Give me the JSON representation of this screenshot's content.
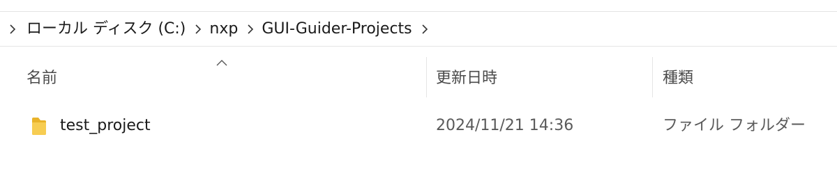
{
  "breadcrumb": {
    "items": [
      {
        "label": "ローカル ディスク (C:)"
      },
      {
        "label": "nxp"
      },
      {
        "label": "GUI-Guider-Projects"
      }
    ]
  },
  "columns": {
    "name": "名前",
    "date_modified": "更新日時",
    "type": "種類",
    "sort_icon": "chevron-up-icon"
  },
  "rows": [
    {
      "icon": "folder-icon",
      "name": "test_project",
      "date_modified": "2024/11/21 14:36",
      "type": "ファイル フォルダー"
    }
  ],
  "colors": {
    "folder": "#f4c542",
    "separator": "#e5e5e5",
    "header_text": "#4a4a4a"
  }
}
